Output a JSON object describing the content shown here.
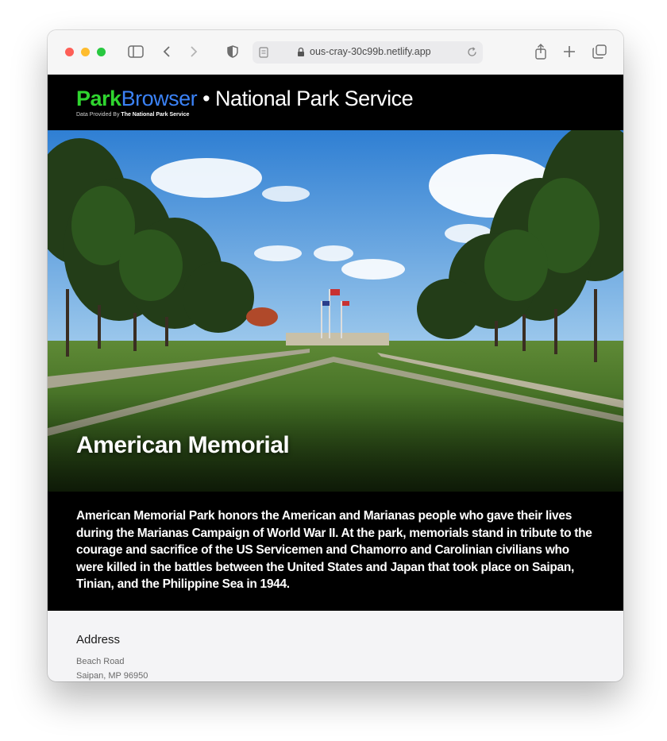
{
  "browser": {
    "url": "ous-cray-30c99b.netlify.app",
    "icons": [
      "sidebar-icon",
      "back-icon",
      "forward-icon",
      "privacy-shield-icon",
      "page-icon",
      "lock-icon",
      "reload-icon",
      "share-icon",
      "new-tab-icon",
      "tabs-overview-icon"
    ]
  },
  "header": {
    "brand_park": "Park",
    "brand_browser": "Browser",
    "brand_rest": " • National Park Service",
    "provided_prefix": "Data Provided By ",
    "provided_source": "The National Park Service",
    "colors": {
      "park": "#2fd52f",
      "browser": "#3b82f6"
    }
  },
  "park": {
    "name": "American Memorial",
    "description": "American Memorial Park honors the American and Marianas people who gave their lives during the Marianas Campaign of World War II. At the park, memorials stand in tribute to the courage and sacrifice of the US Servicemen and Chamorro and Carolinian civilians who were killed in the battles between the United States and Japan that took place on Saipan, Tinian, and the Philippine Sea in 1944."
  },
  "address": {
    "label": "Address",
    "line1": "Beach Road",
    "line2": "Saipan, MP 96950"
  }
}
